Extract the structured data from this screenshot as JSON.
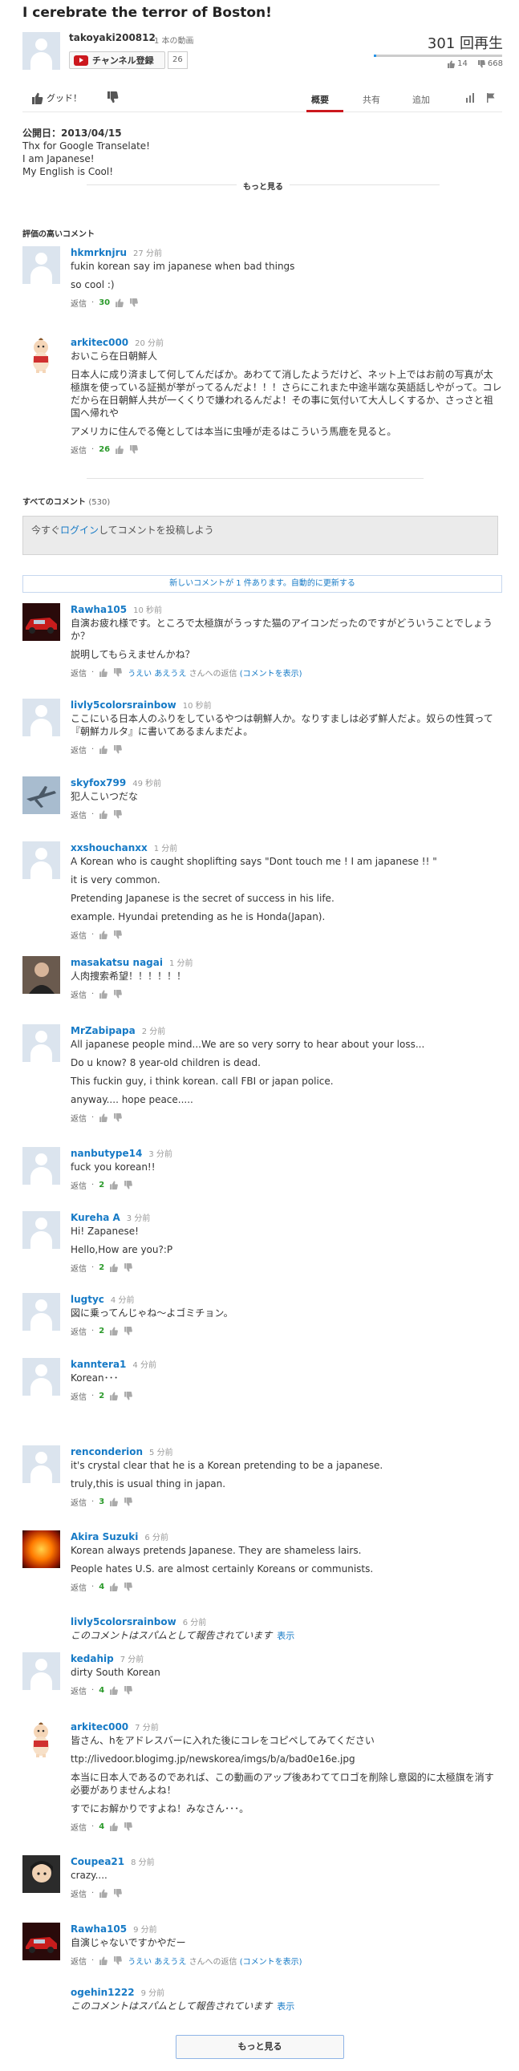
{
  "video": {
    "title": "I cerebrate the terror of Boston!",
    "uploader": "takoyaki200812",
    "video_count": "1 本の動画",
    "subscribe_label": "チャンネル登録",
    "subscriber_count": "26",
    "views": "301 回再生",
    "likes": "14",
    "dislikes": "668",
    "like_ratio": 0.02,
    "accent_color": "#cc181e",
    "link_color": "#167ac6"
  },
  "actions": {
    "like_label": "グッド！",
    "tabs": [
      "概要",
      "共有",
      "追加"
    ],
    "active_tab": "概要"
  },
  "description": {
    "published": "公開日：2013/04/15",
    "lines": [
      "Thx for Google Transelate!",
      "I am Japanese!",
      "My English is Cool!"
    ],
    "show_more": "もっと見る"
  },
  "top_comments_header": "評価の高いコメント",
  "all_comments": {
    "header": "すべてのコメント",
    "count": "(530)",
    "box_prefix": "今すぐ",
    "box_link": "ログイン",
    "box_suffix": "してコメントを投稿しよう",
    "new_comments": "新しいコメントが 1 件あります。自動的に更新する"
  },
  "reply_label": "返信",
  "top_comments": [
    {
      "author": "hkmrknjru",
      "time": "27 分前",
      "avatar": "default",
      "lines": [
        "fukin korean say im japanese when bad things",
        "so cool :)"
      ],
      "score": "30"
    },
    {
      "author": "arkitec000",
      "time": "20 分前",
      "avatar": "doll",
      "lines": [
        "おいこら在日朝鮮人",
        "日本人に成り済まして何してんだばか。あわてて消したようだけど、ネット上ではお前の写真が太極旗を使っている証拠が挙がってるんだよ！！！さらにこれまた中途半端な英語話しやがって。コレだから在日朝鮮人共が一くくりで嫌われるんだよ！その事に気付いて大人しくするか、さっさと祖国へ帰れや",
        "アメリカに住んでる俺としては本当に虫唾が走るはこういう馬鹿を見ると。"
      ],
      "score": "26"
    }
  ],
  "comments": [
    {
      "author": "Rawha105",
      "time": "10 秒前",
      "avatar": "car",
      "lines": [
        "自演お疲れ様です。ところで太極旗がうっすた猫のアイコンだったのですがどういうことでしょうか？",
        "説明してもらえませんかね？"
      ],
      "reply_to": "うえい あえうえ",
      "reply_to_suffix": "さんへの返信",
      "show_comment": "(コメントを表示)"
    },
    {
      "author": "livly5colorsrainbow",
      "time": "10 秒前",
      "avatar": "default",
      "lines": [
        "ここにいる日本人のふりをしているやつは朝鮮人か。なりすましは必ず鮮人だよ。奴らの性質って『朝鮮カルタ』に書いてあるまんまだよ。"
      ]
    },
    {
      "author": "skyfox799",
      "time": "49 秒前",
      "avatar": "jet",
      "lines": [
        "犯人こいつだな"
      ]
    },
    {
      "author": "xxshouchanxx",
      "time": "1 分前",
      "avatar": "default",
      "lines": [
        "A Korean who is caught shoplifting says \"Dont touch me ! I am japanese !! \"",
        "it is very common.",
        "Pretending Japanese is the secret of success in his life.",
        "example. Hyundai pretending as he is Honda(Japan)."
      ]
    },
    {
      "author": "masakatsu nagai",
      "time": "1 分前",
      "avatar": "person",
      "lines": [
        "人肉捜索希望！！！！！！"
      ]
    },
    {
      "author": "MrZabipapa",
      "time": "2 分前",
      "avatar": "default",
      "lines": [
        "All japanese people mind...We are so very sorry to hear about your loss...",
        "Do u know? 8 year-old children is dead.",
        "This fuckin guy, i think korean. call FBI or japan police.",
        "anyway.... hope peace....."
      ]
    },
    {
      "author": "nanbutype14",
      "time": "3 分前",
      "avatar": "default",
      "lines": [
        "fuck you korean!!"
      ],
      "score": "2"
    },
    {
      "author": "Kureha A",
      "time": "3 分前",
      "avatar": "default",
      "lines": [
        "Hi! Zapanese!",
        "Hello,How are you?:P"
      ],
      "score": "2"
    },
    {
      "author": "lugtyc",
      "time": "4 分前",
      "avatar": "default",
      "lines": [
        "図に乗ってんじゃね～よゴミチョン。"
      ],
      "score": "2"
    },
    {
      "author": "kanntera1",
      "time": "4 分前",
      "avatar": "default",
      "lines": [
        "Korean･･･"
      ],
      "score": "2"
    },
    {
      "author": "renconderion",
      "time": "5 分前",
      "avatar": "default",
      "lines": [
        "it's crystal clear that he is a Korean pretending to be a japanese.",
        "truly,this is usual thing in japan."
      ],
      "score": "3"
    },
    {
      "author": "Akira Suzuki",
      "time": "6 分前",
      "avatar": "sun",
      "lines": [
        "Korean always pretends Japanese. They are shameless lairs.",
        "People hates U.S. are almost certainly Koreans or communists."
      ],
      "score": "4"
    },
    {
      "author": "livly5colorsrainbow",
      "time": "6 分前",
      "avatar": "none",
      "spam": true,
      "spam_text": "このコメントはスパムとして報告されています",
      "show_label": "表示"
    },
    {
      "author": "kedahip",
      "time": "7 分前",
      "avatar": "default",
      "lines": [
        "dirty South Korean"
      ],
      "score": "4"
    },
    {
      "author": "arkitec000",
      "time": "7 分前",
      "avatar": "doll",
      "lines": [
        "皆さん、hをアドレスバーに入れた後にコレをコピペしてみてください",
        "ttp://livedoor.blogimg.jp/newskorea/imgs/b/a/bad0e16e.jpg",
        "本当に日本人であるのであれば、この動画のアップ後あわててロゴを削除し意図的に太極旗を消す必要がありませんよね！",
        "すでにお解かりですよね！みなさん･･･。"
      ],
      "score": "4"
    },
    {
      "author": "Coupea21",
      "time": "8 分前",
      "avatar": "anime",
      "lines": [
        "crazy...."
      ]
    },
    {
      "author": "Rawha105",
      "time": "9 分前",
      "avatar": "car",
      "lines": [
        "自演じゃないですかやだー"
      ],
      "reply_to": "うえい あえうえ",
      "reply_to_suffix": "さんへの返信",
      "show_comment": "(コメントを表示)"
    },
    {
      "author": "ogehin1222",
      "time": "9 分前",
      "avatar": "none",
      "spam": true,
      "spam_text": "このコメントはスパムとして報告されています",
      "show_label": "表示"
    }
  ],
  "load_more": "もっと見る"
}
